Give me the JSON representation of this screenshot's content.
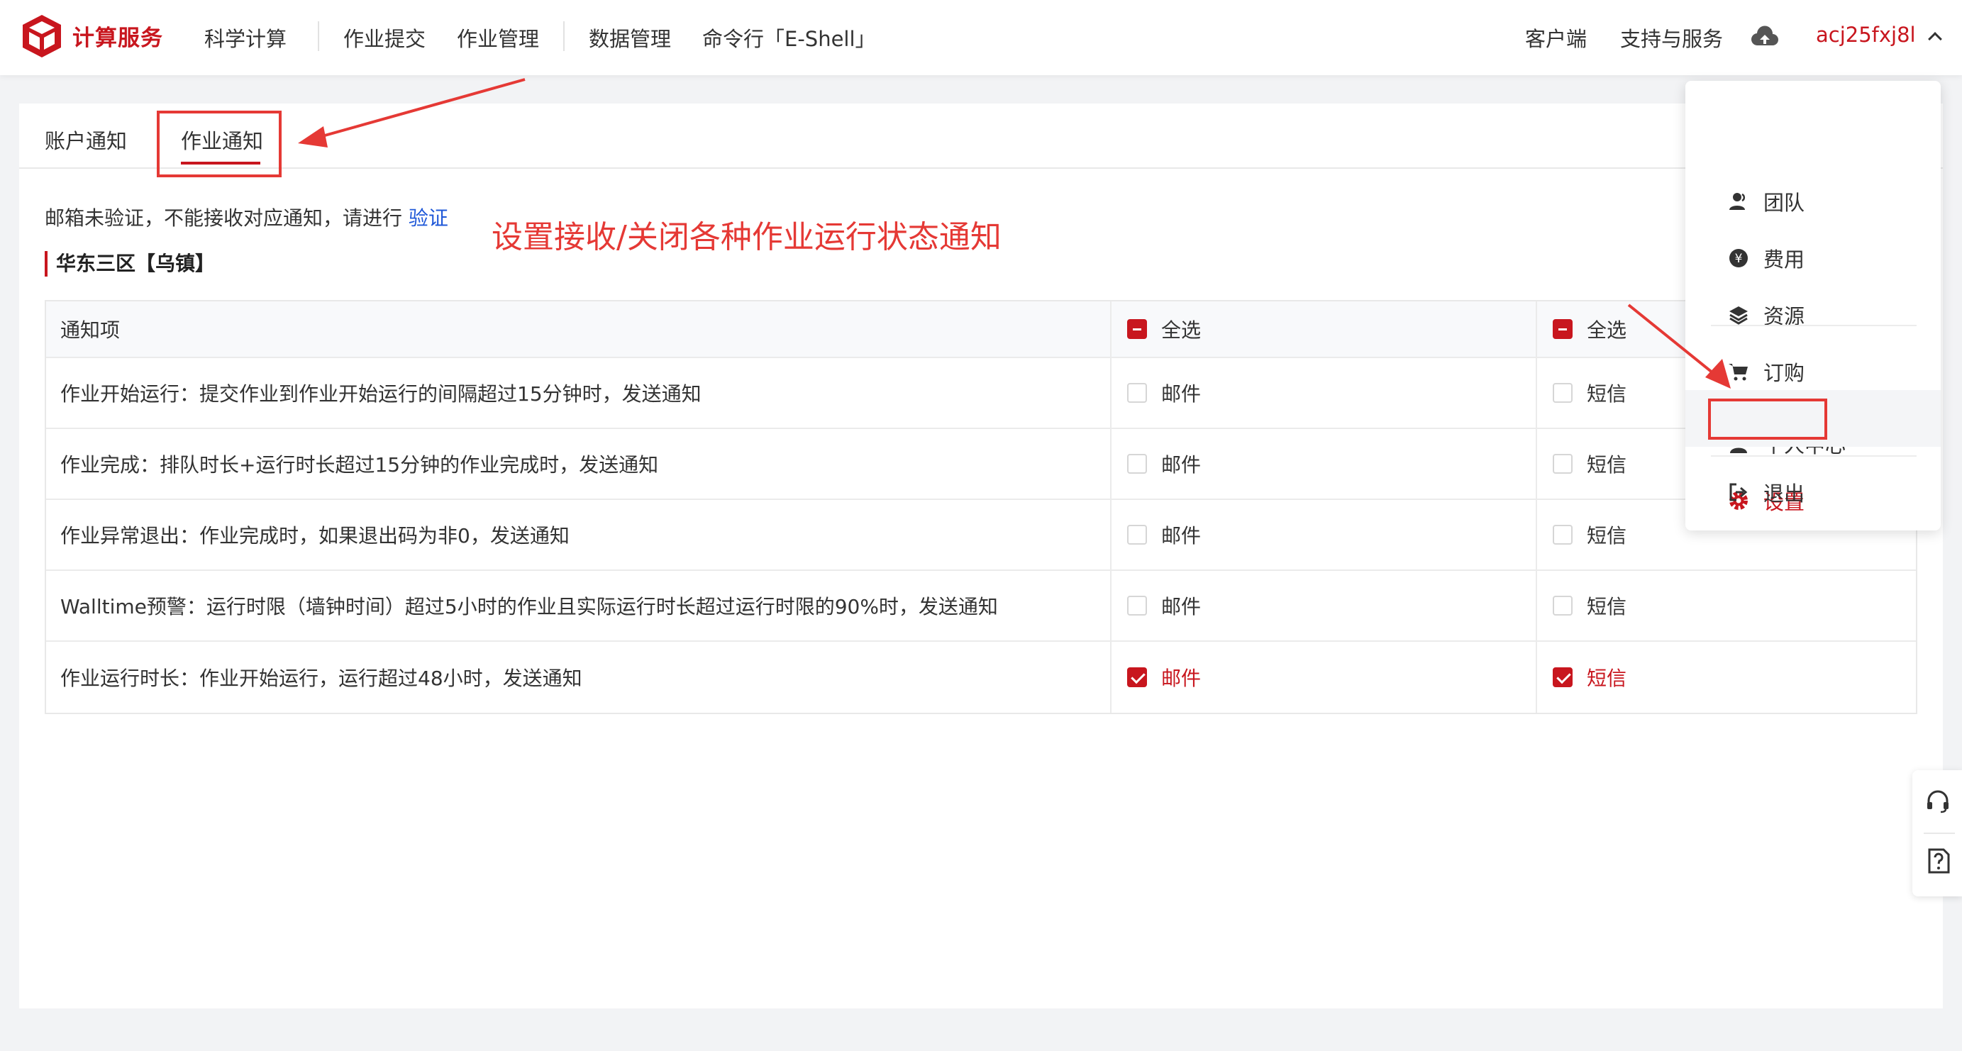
{
  "brand": {
    "name": "计算服务"
  },
  "nav": {
    "items": [
      "科学计算",
      "作业提交",
      "作业管理",
      "数据管理",
      "命令行「E-Shell」"
    ],
    "client": "客户端",
    "support": "支持与服务",
    "user": "acj25fxj8l"
  },
  "tabs": [
    "账户通知",
    "作业通知"
  ],
  "notice": {
    "text": "邮箱未验证，不能接收对应通知，请进行 ",
    "link": "验证"
  },
  "annotation": "设置接收/关闭各种作业运行状态通知",
  "region": "华东三区【乌镇】",
  "table": {
    "header": {
      "item": "通知项",
      "select_all": "全选"
    },
    "rows": [
      {
        "item": "作业开始运行：提交作业到作业开始运行的间隔超过15分钟时，发送通知",
        "email": "邮件",
        "sms": "短信",
        "email_checked": false,
        "sms_checked": false
      },
      {
        "item": "作业完成：排队时长+运行时长超过15分钟的作业完成时，发送通知",
        "email": "邮件",
        "sms": "短信",
        "email_checked": false,
        "sms_checked": false
      },
      {
        "item": "作业异常退出：作业完成时，如果退出码为非0，发送通知",
        "email": "邮件",
        "sms": "短信",
        "email_checked": false,
        "sms_checked": false
      },
      {
        "item": "Walltime预警：运行时限（墙钟时间）超过5小时的作业且实际运行时长超过运行时限的90%时，发送通知",
        "email": "邮件",
        "sms": "短信",
        "email_checked": false,
        "sms_checked": false
      },
      {
        "item": "作业运行时长：作业开始运行，运行超过48小时，发送通知",
        "email": "邮件",
        "sms": "短信",
        "email_checked": true,
        "sms_checked": true
      }
    ]
  },
  "dropdown": {
    "items": [
      "团队",
      "费用",
      "资源",
      "订购",
      "个人中心",
      "设置",
      "退出"
    ]
  },
  "colors": {
    "brand_red": "#c8161e",
    "annotation_red": "#e53935",
    "link_blue": "#1f58d8"
  }
}
